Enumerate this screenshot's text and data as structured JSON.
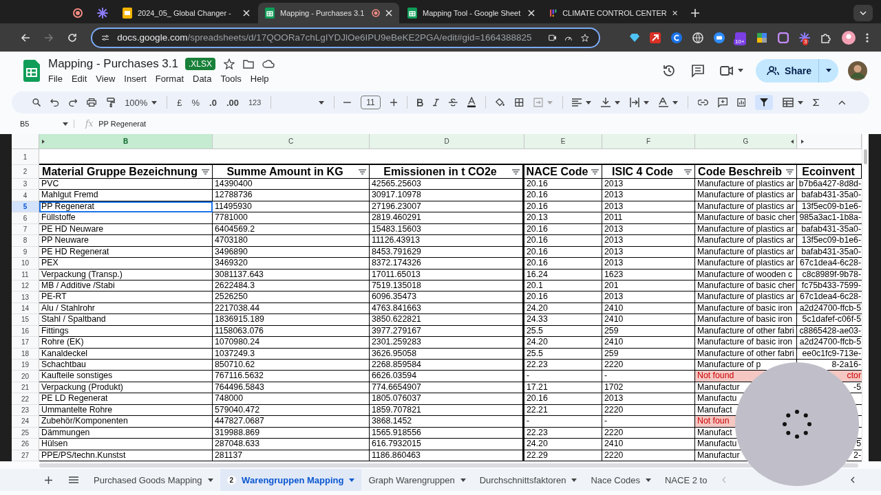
{
  "browser": {
    "tabs": [
      {
        "title": "2024_05_ Global Changer - ",
        "kind": "slides",
        "selected": false,
        "recording": false
      },
      {
        "title": "Mapping - Purchases 3.1",
        "kind": "sheets",
        "selected": true,
        "recording": true
      },
      {
        "title": "Mapping Tool - Google Sheet",
        "kind": "sheets",
        "selected": false,
        "recording": false
      },
      {
        "title": "CLIMATE CONTROL CENTER",
        "kind": "grid",
        "selected": false,
        "recording": false
      }
    ],
    "url_host": "docs.google.com",
    "url_path": "/spreadsheets/d/17QOORa7chLgIYDJlOe6IPU9eBeKE2PGA/edit#gid=1664388825",
    "badges": [
      "10+",
      "3"
    ]
  },
  "doc": {
    "title": "Mapping - Purchases 3.1",
    "format": ".XLSX",
    "menu": [
      "File",
      "Edit",
      "View",
      "Insert",
      "Format",
      "Data",
      "Tools",
      "Help"
    ],
    "share": "Share"
  },
  "toolbar": {
    "zoom": "100%",
    "currency": "£",
    "percent": "%",
    "decrease_decimal": ".0",
    "increase_decimal": ".00",
    "number_format": "123",
    "font_size": "11"
  },
  "header_rows": [
    "1",
    "2"
  ],
  "formula_bar": {
    "name_box": "B5",
    "fx": "fx",
    "formula": "PP Regenerat"
  },
  "columns": [
    {
      "letter": "B",
      "selected": true
    },
    {
      "letter": "C",
      "selected": false
    },
    {
      "letter": "D",
      "selected": false
    },
    {
      "letter": "E",
      "selected": false
    },
    {
      "letter": "F",
      "selected": false
    },
    {
      "letter": "G",
      "selected": false
    }
  ],
  "headers": [
    "Material Gruppe Bezeichnung",
    "Summe Amount in KG",
    "Emissionen in t CO2e",
    "NACE Code",
    "ISIC 4 Code",
    "Code Beschreib",
    "Ecoinvent"
  ],
  "rows": [
    {
      "n": "3",
      "b": "PVC",
      "c": "14390400",
      "d": "42565.25603",
      "e": "20.16",
      "f": "2013",
      "g": "Manufacture of plastics ar",
      "g_error": false,
      "h": "b7b6a427-8d8d-",
      "h_error": false,
      "selected": false
    },
    {
      "n": "4",
      "b": "Mahlgut Fremd",
      "c": "12788736",
      "d": "30917.10978",
      "e": "20.16",
      "f": "2013",
      "g": "Manufacture of plastics ar",
      "g_error": false,
      "h": "bafab431-35a0-",
      "h_error": false,
      "selected": false
    },
    {
      "n": "5",
      "b": "PP Regenerat",
      "c": "11495930",
      "d": "27196.23007",
      "e": "20.16",
      "f": "2013",
      "g": "Manufacture of plastics ar",
      "g_error": false,
      "h": "13f5ec09-b1e6-",
      "h_error": false,
      "selected": true
    },
    {
      "n": "6",
      "b": "Füllstoffe",
      "c": "7781000",
      "d": "2819.460291",
      "e": "20.13",
      "f": "2011",
      "g": "Manufacture of basic cher",
      "g_error": false,
      "h": "985a3ac1-1b8a-",
      "h_error": false,
      "selected": false
    },
    {
      "n": "7",
      "b": "PE HD Neuware",
      "c": "6404569.2",
      "d": "15483.15603",
      "e": "20.16",
      "f": "2013",
      "g": "Manufacture of plastics ar",
      "g_error": false,
      "h": "bafab431-35a0-",
      "h_error": false,
      "selected": false
    },
    {
      "n": "8",
      "b": "PP Neuware",
      "c": "4703180",
      "d": "11126.43913",
      "e": "20.16",
      "f": "2013",
      "g": "Manufacture of plastics ar",
      "g_error": false,
      "h": "13f5ec09-b1e6-",
      "h_error": false,
      "selected": false
    },
    {
      "n": "9",
      "b": "PE HD Regenerat",
      "c": "3496890",
      "d": "8453.791629",
      "e": "20.16",
      "f": "2013",
      "g": "Manufacture of plastics ar",
      "g_error": false,
      "h": "bafab431-35a0-",
      "h_error": false,
      "selected": false
    },
    {
      "n": "10",
      "b": "PEX",
      "c": "3469320",
      "d": "8372.174326",
      "e": "20.16",
      "f": "2013",
      "g": "Manufacture of plastics ar",
      "g_error": false,
      "h": "67c1dea4-6c28-",
      "h_error": false,
      "selected": false
    },
    {
      "n": "11",
      "b": "Verpackung (Transp.)",
      "c": "3081137.643",
      "d": "17011.65013",
      "e": "16.24",
      "f": "1623",
      "g": "Manufacture of wooden c",
      "g_error": false,
      "h": "c8c8989f-9b78-",
      "h_error": false,
      "selected": false
    },
    {
      "n": "12",
      "b": "MB / Additive /Stabi",
      "c": "2622484.3",
      "d": "7519.135018",
      "e": "20.1",
      "f": "201",
      "g": "Manufacture of basic cher",
      "g_error": false,
      "h": "fc75b433-7599-",
      "h_error": false,
      "selected": false
    },
    {
      "n": "13",
      "b": "PE-RT",
      "c": "2526250",
      "d": "6096.35473",
      "e": "20.16",
      "f": "2013",
      "g": "Manufacture of plastics ar",
      "g_error": false,
      "h": "67c1dea4-6c28-",
      "h_error": false,
      "selected": false
    },
    {
      "n": "14",
      "b": "Alu / Stahlrohr",
      "c": "2217038.44",
      "d": "4763.841663",
      "e": "24.20",
      "f": "2410",
      "g": "Manufacture of basic iron",
      "g_error": false,
      "h": "a2d24700-ffcb-5",
      "h_error": false,
      "selected": false
    },
    {
      "n": "15",
      "b": "Stahl / Spaltband",
      "c": "1836915.189",
      "d": "3850.622821",
      "e": "24.33",
      "f": "2410",
      "g": "Manufacture of basic iron",
      "g_error": false,
      "h": "5c1dafef-c06f-5",
      "h_error": false,
      "selected": false
    },
    {
      "n": "16",
      "b": "Fittings",
      "c": "1158063.076",
      "d": "3977.279167",
      "e": "25.5",
      "f": "259",
      "g": "Manufacture of other fabri",
      "g_error": false,
      "h": "c8865428-ae03-",
      "h_error": false,
      "selected": false
    },
    {
      "n": "17",
      "b": "Rohre (EK)",
      "c": "1070980.24",
      "d": "2301.259283",
      "e": "24.20",
      "f": "2410",
      "g": "Manufacture of basic iron",
      "g_error": false,
      "h": "a2d24700-ffcb-5",
      "h_error": false,
      "selected": false
    },
    {
      "n": "18",
      "b": "Kanaldeckel",
      "c": "1037249.3",
      "d": "3626.95058",
      "e": "25.5",
      "f": "259",
      "g": "Manufacture of other fabri",
      "g_error": false,
      "h": "ee0c1fc9-713e-",
      "h_error": false,
      "selected": false
    },
    {
      "n": "19",
      "b": "Schachtbau",
      "c": "850710.62",
      "d": "2268.859584",
      "e": "22.23",
      "f": "2220",
      "g": "Manufacture of p",
      "g_error": false,
      "h": "8-2a16-",
      "h_error": false,
      "selected": false
    },
    {
      "n": "20",
      "b": "Kaufteile sonstiges",
      "c": "767116.5632",
      "d": "6626.03594",
      "e": "-",
      "f": "-",
      "g": "Not found",
      "g_error": true,
      "h": "ctor",
      "h_error": true,
      "selected": false
    },
    {
      "n": "21",
      "b": "Verpackung (Produkt)",
      "c": "764496.5843",
      "d": "774.6654907",
      "e": "17.21",
      "f": "1702",
      "g": "Manufactur",
      "g_error": false,
      "h": "-5",
      "h_error": false,
      "selected": false
    },
    {
      "n": "22",
      "b": "PE LD Regenerat",
      "c": "748000",
      "d": "1805.076037",
      "e": "20.16",
      "f": "2013",
      "g": "Manufactu",
      "g_error": false,
      "selected": false
    },
    {
      "n": "23",
      "b": "Ummantelte Rohre",
      "c": "579040.472",
      "d": "1859.707821",
      "e": "22.21",
      "f": "2220",
      "g": "Manufact",
      "g_error": false,
      "selected": false
    },
    {
      "n": "24",
      "b": "Zubehör/Komponenten",
      "c": "447827.0687",
      "d": "3868.1452",
      "e": "-",
      "f": "-",
      "g": "Not foun",
      "g_error": true,
      "selected": false
    },
    {
      "n": "25",
      "b": "Dämmungen",
      "c": "319988.869",
      "d": "1565.918556",
      "e": "22.23",
      "f": "2220",
      "g": "Manufact",
      "g_error": false,
      "selected": false
    },
    {
      "n": "26",
      "b": "Hülsen",
      "c": "287048.633",
      "d": "616.7932015",
      "e": "24.20",
      "f": "2410",
      "g": "Manufactu",
      "g_error": false,
      "h": "5",
      "h_error": false,
      "selected": false
    },
    {
      "n": "27",
      "b": "PPE/PS/techn.Kunstst",
      "c": "281137",
      "d": "1186.860463",
      "e": "22.29",
      "f": "2220",
      "g": "Manufactur",
      "g_error": false,
      "h": "2-",
      "h_error": false,
      "selected": false
    }
  ],
  "sheets": [
    {
      "name": "Purchased Goods Mapping",
      "selected": false
    },
    {
      "name": "Warengruppen Mapping",
      "selected": true,
      "badge": "2"
    },
    {
      "name": "Graph Warengruppen",
      "selected": false
    },
    {
      "name": "Durchschnittsfaktoren",
      "selected": false
    },
    {
      "name": "Nace Codes",
      "selected": false
    },
    {
      "name": "NACE 2 to",
      "selected": false
    }
  ]
}
